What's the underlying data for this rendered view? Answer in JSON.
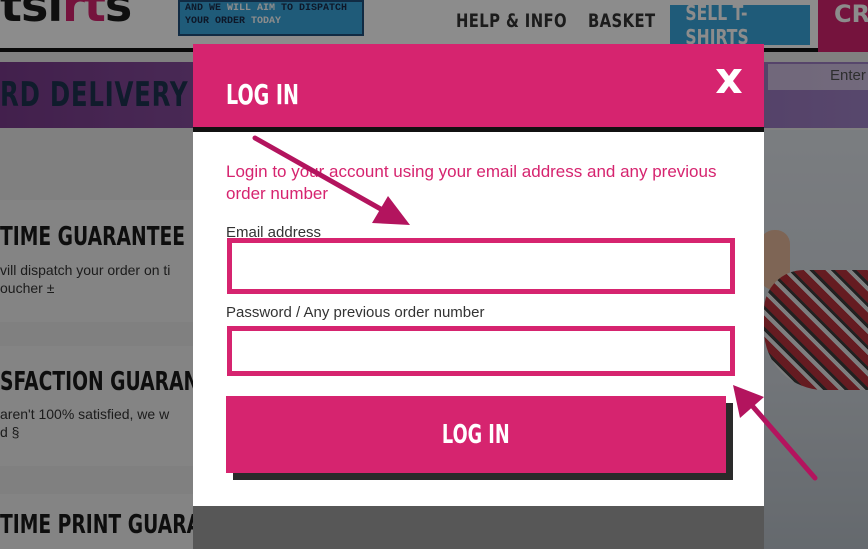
{
  "background": {
    "logo": {
      "prefix": "tsi",
      "accent": "rt",
      "suffix": "s"
    },
    "promo": {
      "line1_a": "AND WE ",
      "line1_b": "WILL AIM",
      "line1_c": " TO DISPATCH",
      "line2_a": "YOUR ORDER ",
      "line2_b": "TODAY"
    },
    "nav": {
      "help": "HELP & INFO",
      "basket": "BASKET",
      "sell": "SELL T-SHIRTS",
      "create": "CRE"
    },
    "banner": {
      "text": "RD DELIVERY",
      "search_placeholder": "Enter"
    },
    "guarantees": [
      {
        "title": "TIME GUARANTEE",
        "line1": "vill dispatch your order on ti",
        "line2": "oucher ±"
      },
      {
        "title": "SFACTION GUARANTEE",
        "line1": "aren't 100% satisfied, we w",
        "line2": "d §"
      },
      {
        "title": "TIME PRINT GUARANT",
        "line1": "",
        "line2": ""
      }
    ]
  },
  "modal": {
    "title": "LOG IN",
    "intro": "Login to your account using your email address and any previous order number",
    "email_label": "Email address",
    "email_value": "",
    "password_label": "Password / Any previous order number",
    "password_value": "",
    "submit_label": "LOG IN"
  },
  "colors": {
    "accent": "#d6246f",
    "dark": "#111111",
    "annotation": "#b3145e"
  }
}
